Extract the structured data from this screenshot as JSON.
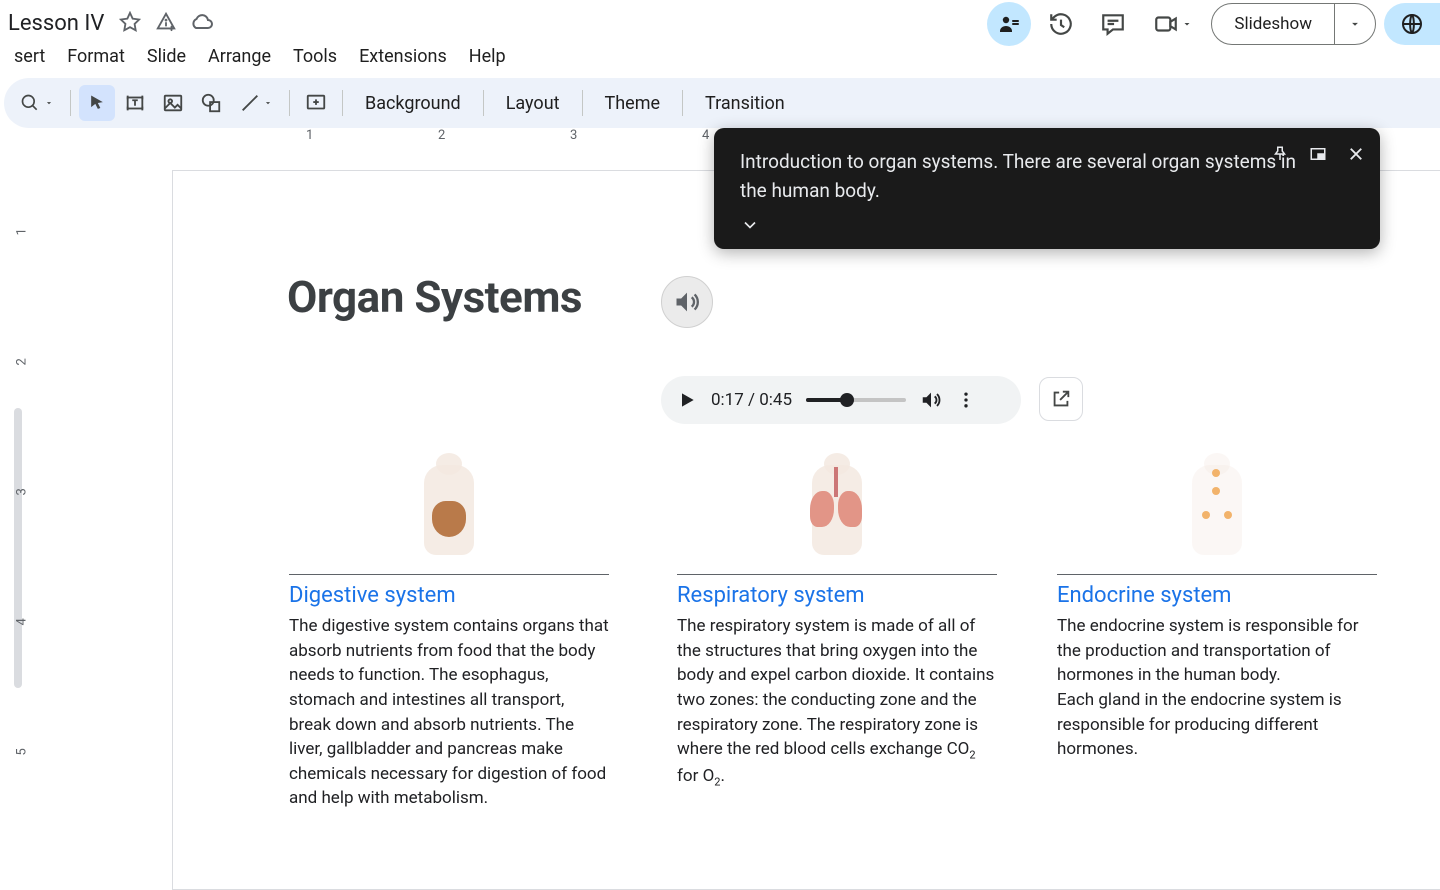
{
  "doc": {
    "title": "Lesson IV"
  },
  "menus": {
    "insert": "sert",
    "format": "Format",
    "slide": "Slide",
    "arrange": "Arrange",
    "tools": "Tools",
    "extensions": "Extensions",
    "help": "Help"
  },
  "toolbar": {
    "background": "Background",
    "layout": "Layout",
    "theme": "Theme",
    "transition": "Transition"
  },
  "header": {
    "slideshow": "Slideshow"
  },
  "ruler_h": {
    "n1": "1",
    "n2": "2",
    "n3": "3",
    "n4": "4"
  },
  "ruler_v": {
    "n1": "1",
    "n2": "2",
    "n3": "3",
    "n4": "4",
    "n5": "5"
  },
  "slide": {
    "title": "Organ Systems",
    "col1_head": "Digestive system",
    "col1_body": "The digestive system contains organs that absorb nutrients from food that the body needs to function. The esophagus, stomach and intestines all transport, break down and absorb nutrients. The liver, gallbladder and pancreas make chemicals necessary for digestion of food and help with metabolism.",
    "col2_head": "Respiratory system",
    "col2_body_a": "The respiratory system is made of all of the structures that bring oxygen into the body and expel carbon dioxide. It contains two zones: the conducting zone and the respiratory zone. The respiratory zone is where the red blood cells exchange CO",
    "col2_body_b": " for O",
    "col2_body_c": ".",
    "sub2": "2",
    "col3_head": "Endocrine system",
    "col3_body": "The endocrine system is responsible for the production and transportation of hormones in the human body.\nEach gland in the endocrine system is responsible for producing different hormones."
  },
  "audio": {
    "time": "0:17 / 0:45"
  },
  "caption": {
    "text": "Introduction to organ systems. There are several organ systems in the human body."
  }
}
